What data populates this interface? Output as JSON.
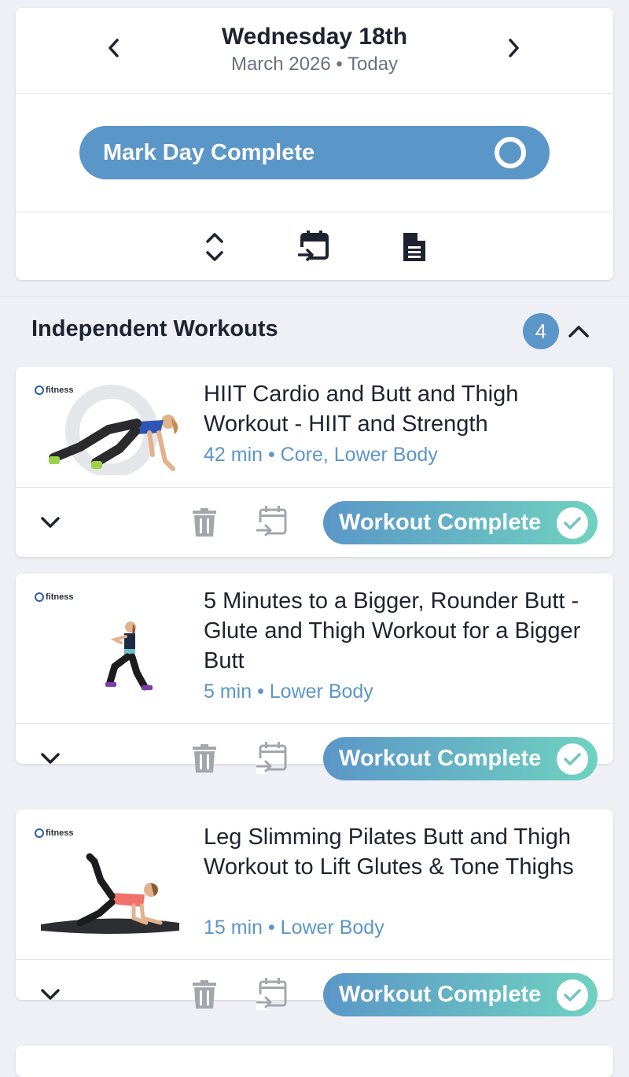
{
  "day": {
    "title": "Wednesday 18th",
    "subtitle": "March 2026 • Today"
  },
  "mark_day": {
    "label": "Mark Day Complete"
  },
  "toolbar": {
    "icons": [
      "expand-collapse-icon",
      "move-to-calendar-icon",
      "notes-document-icon"
    ]
  },
  "section": {
    "title": "Independent Workouts",
    "count": "4"
  },
  "brand": {
    "name": "fitness"
  },
  "workouts": [
    {
      "title": "HIIT Cardio and Butt and Thigh Workout - HIIT and Strength",
      "meta": "42 min • Core, Lower Body",
      "complete_label": "Workout Complete"
    },
    {
      "title": "5 Minutes to a Bigger, Rounder Butt - Glute and Thigh Workout for a Bigger Butt",
      "meta": "5 min • Lower Body",
      "complete_label": "Workout Complete"
    },
    {
      "title": "Leg Slimming Pilates Butt and Thigh Workout to Lift Glutes & Tone Thighs",
      "meta": "15 min • Lower Body",
      "complete_label": "Workout Complete"
    }
  ],
  "colors": {
    "accent": "#5b96c8",
    "gradient_end": "#6fd2c0",
    "background": "#eef0f5"
  }
}
